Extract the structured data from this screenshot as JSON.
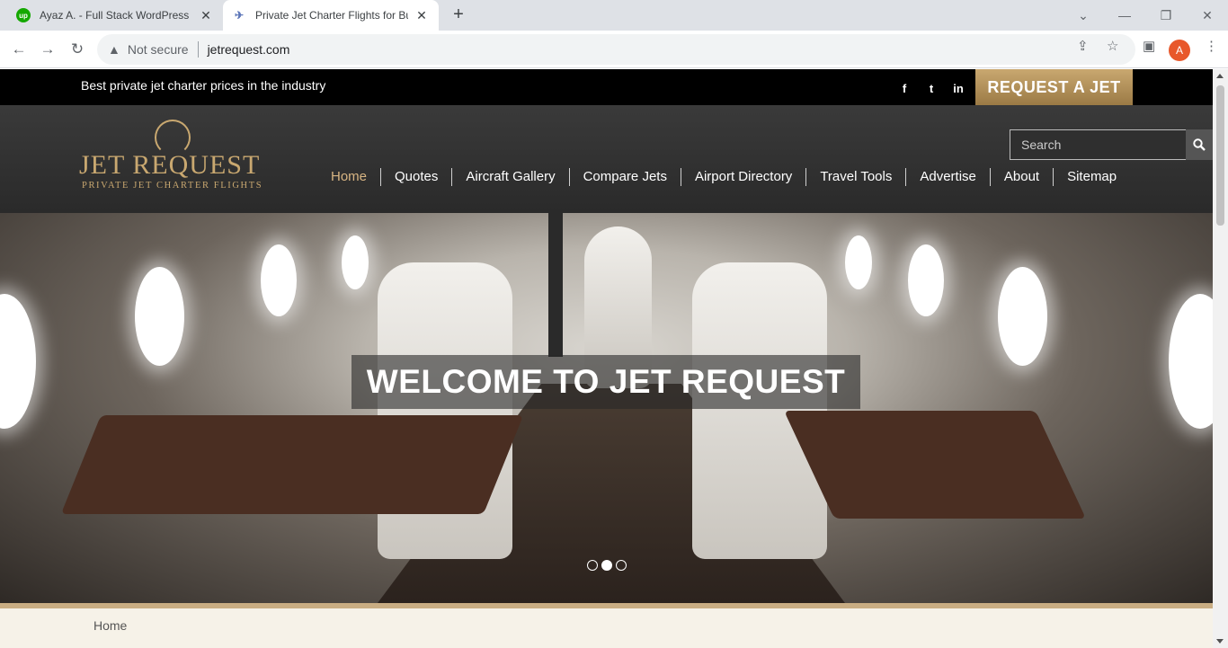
{
  "browser": {
    "tabs": [
      {
        "title": "Ayaz A. - Full Stack WordPress De",
        "icon": "upwork-icon"
      },
      {
        "title": "Private Jet Charter Flights for Bus",
        "icon": "jet-icon"
      }
    ],
    "new_tab_label": "+",
    "address": {
      "security_label": "Not secure",
      "url": "jetrequest.com"
    },
    "profile_initial": "A",
    "accent_color": "#e8582b"
  },
  "site": {
    "tagline": "Best private jet charter prices in the industry",
    "social": [
      "f",
      "t",
      "in"
    ],
    "request_button": "REQUEST A JET",
    "logo": {
      "name": "JET REQUEST",
      "subtitle": "PRIVATE JET CHARTER FLIGHTS"
    },
    "search_placeholder": "Search",
    "nav": [
      "Home",
      "Quotes",
      "Aircraft Gallery",
      "Compare Jets",
      "Airport Directory",
      "Travel Tools",
      "Advertise",
      "About",
      "Sitemap"
    ],
    "active_nav": "Home",
    "hero": {
      "headline": "WELCOME TO JET REQUEST",
      "slides": 3,
      "active_slide": 2
    },
    "breadcrumb": "Home",
    "gold_color": "#c9a870"
  }
}
